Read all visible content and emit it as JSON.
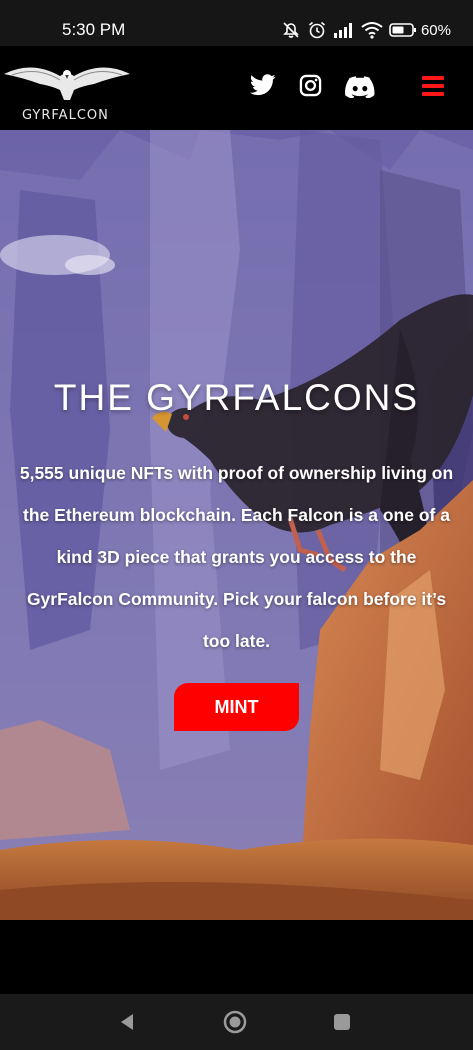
{
  "status_bar": {
    "time": "5:30 PM",
    "battery_percent": "60%",
    "icons": [
      "mute-icon",
      "alarm-icon",
      "signal-icon",
      "wifi-icon",
      "battery-icon"
    ]
  },
  "header": {
    "logo_text": "GYRFALCON",
    "social_links": [
      "twitter-icon",
      "instagram-icon",
      "discord-icon"
    ],
    "menu_icon": "hamburger-menu-icon"
  },
  "hero": {
    "title": "THE GYRFALCONS",
    "description": "5,555 unique NFTs with proof of ownership living on the Ethereum blockchain. Each Falcon is a one of a kind 3D piece that grants you access to the GyrFalcon Community. Pick your falcon before it’s too late.",
    "mint_label": "MINT"
  },
  "nav_bar": {
    "buttons": [
      "back-icon",
      "home-icon",
      "recents-icon"
    ]
  },
  "colors": {
    "accent": "#ff0000",
    "header_bg": "#000000",
    "status_bar_bg": "#161616"
  }
}
